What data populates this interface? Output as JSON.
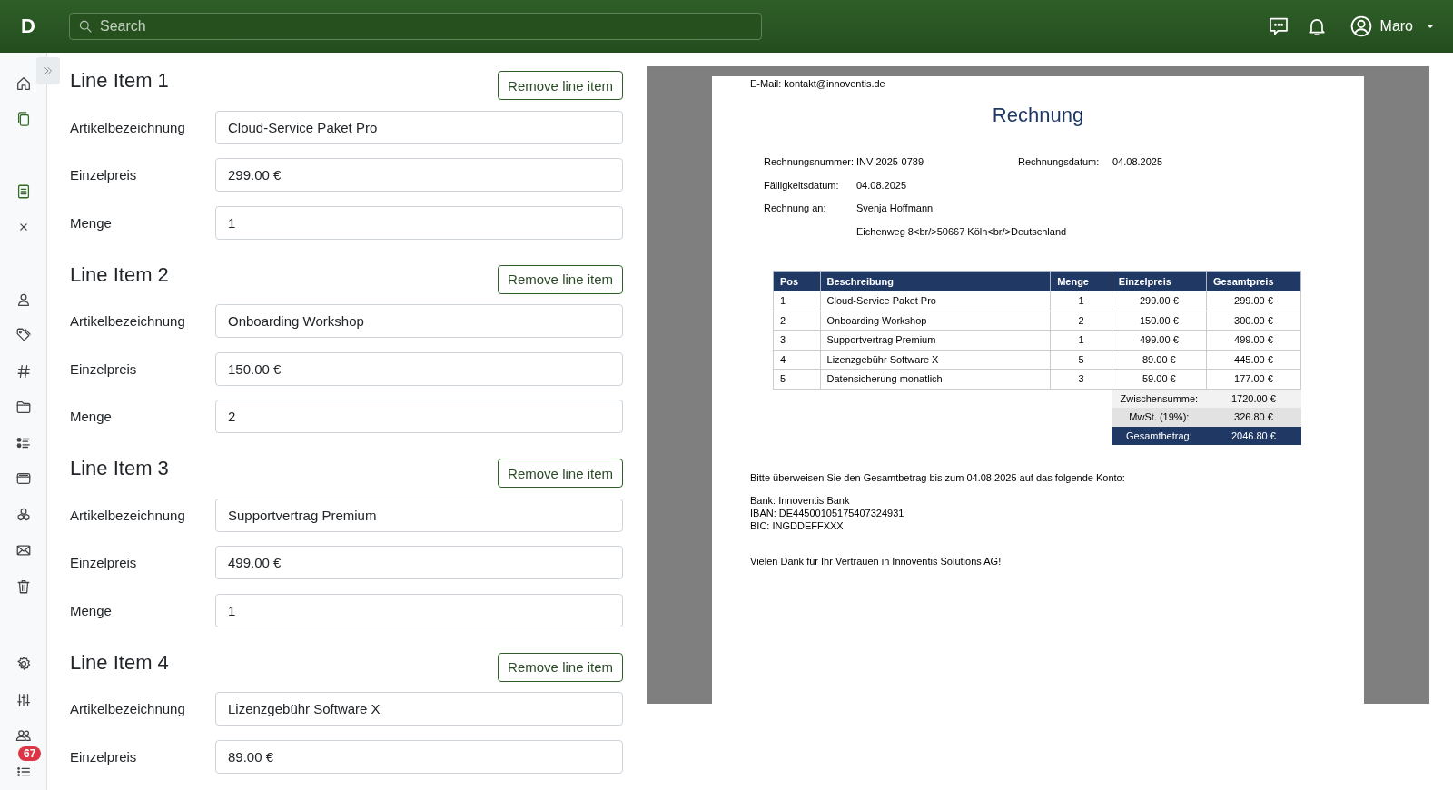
{
  "header": {
    "logo": "D",
    "search": {
      "placeholder": "Search"
    },
    "user": "Maro"
  },
  "sidebar": {
    "groups": [
      [
        {
          "kind": "home",
          "active": false
        },
        {
          "kind": "copy",
          "active": true
        }
      ],
      [
        {
          "kind": "document",
          "active": true
        },
        {
          "kind": "close",
          "active": false
        }
      ],
      [
        {
          "kind": "person",
          "active": false
        },
        {
          "kind": "tag",
          "active": false
        },
        {
          "kind": "hash",
          "active": false
        },
        {
          "kind": "folder",
          "active": false
        },
        {
          "kind": "list",
          "active": false
        },
        {
          "kind": "cards",
          "active": false
        },
        {
          "kind": "cubes",
          "active": false
        },
        {
          "kind": "mail",
          "active": false
        },
        {
          "kind": "trash",
          "active": false
        }
      ],
      [
        {
          "kind": "gear",
          "active": false
        },
        {
          "kind": "sliders",
          "active": false
        },
        {
          "kind": "users",
          "active": false
        },
        {
          "kind": "checklist",
          "active": false,
          "badge": "67"
        }
      ]
    ]
  },
  "line_items": [
    {
      "title": "Line Item 1",
      "button": "Remove line item",
      "fields": [
        {
          "label": "Artikelbezeichnung",
          "value": "Cloud-Service Paket Pro"
        },
        {
          "label": "Einzelpreis",
          "value": "299.00 €"
        },
        {
          "label": "Menge",
          "value": "1"
        }
      ]
    },
    {
      "title": "Line Item 2",
      "button": "Remove line item",
      "fields": [
        {
          "label": "Artikelbezeichnung",
          "value": "Onboarding Workshop"
        },
        {
          "label": "Einzelpreis",
          "value": "150.00 €"
        },
        {
          "label": "Menge",
          "value": "2"
        }
      ]
    },
    {
      "title": "Line Item 3",
      "button": "Remove line item",
      "fields": [
        {
          "label": "Artikelbezeichnung",
          "value": "Supportvertrag Premium"
        },
        {
          "label": "Einzelpreis",
          "value": "499.00 €"
        },
        {
          "label": "Menge",
          "value": "1"
        }
      ]
    },
    {
      "title": "Line Item 4",
      "button": "Remove line item",
      "fields": [
        {
          "label": "Artikelbezeichnung",
          "value": "Lizenzgebühr Software X"
        },
        {
          "label": "Einzelpreis",
          "value": "89.00 €"
        }
      ]
    }
  ],
  "invoice": {
    "email": "E-Mail: kontakt@innoventis.de",
    "title": "Rechnung",
    "meta_rows": [
      [
        {
          "label": "Rechnungsnummer:",
          "value": "INV-2025-0789"
        },
        {
          "label": "Rechnungsdatum:",
          "value": "04.08.2025"
        }
      ],
      [
        {
          "label": "Fälligkeitsdatum:",
          "value": "04.08.2025"
        }
      ],
      [
        {
          "label": "Rechnung an:",
          "value": "Svenja Hoffmann"
        }
      ],
      [
        {
          "value": "Eichenweg 8<br/>50667 Köln<br/>Deutschland"
        }
      ]
    ],
    "table": {
      "columns": [
        "Pos",
        "Beschreibung",
        "Menge",
        "Einzelpreis",
        "Gesamtpreis"
      ],
      "rows": [
        [
          "1",
          "Cloud-Service Paket Pro",
          "1",
          "299.00 €",
          "299.00 €"
        ],
        [
          "2",
          "Onboarding Workshop",
          "2",
          "150.00 €",
          "300.00 €"
        ],
        [
          "3",
          "Supportvertrag Premium",
          "1",
          "499.00 €",
          "499.00 €"
        ],
        [
          "4",
          "Lizenzgebühr Software X",
          "5",
          "89.00 €",
          "445.00 €"
        ],
        [
          "5",
          "Datensicherung monatlich",
          "3",
          "59.00 €",
          "177.00 €"
        ]
      ]
    },
    "totals": [
      {
        "kind": "subtotal",
        "label": "Zwischensumme:",
        "value": "1720.00 €"
      },
      {
        "kind": "tax",
        "label": "MwSt. (19%):",
        "value": "326.80 €"
      },
      {
        "kind": "total",
        "label": "Gesamtbetrag:",
        "value": "2046.80 €"
      }
    ],
    "payment_note": "Bitte überweisen Sie den Gesamtbetrag bis zum 04.08.2025 auf das folgende Konto:",
    "bank_lines": [
      "Bank: Innoventis Bank",
      "IBAN: DE44500105175407324931",
      "BIC: INGDDEFFXXX"
    ],
    "thanks": "Vielen Dank für Ihr Vertrauen in Innoventis Solutions AG!"
  }
}
